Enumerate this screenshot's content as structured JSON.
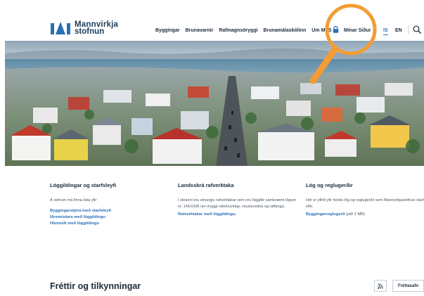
{
  "logo": {
    "line1": "Mannvirkja",
    "line2": "stofnun"
  },
  "nav": {
    "items": [
      "Byggingar",
      "Brunavarnir",
      "Rafmagnsöryggi",
      "Brunamálaskólinn",
      "Um MVS"
    ],
    "my_pages": "Mínar Síður",
    "lang_is": "IS",
    "lang_en": "EN",
    "lock_icon": "lock-icon",
    "search_icon": "search-icon"
  },
  "hero": {
    "description": "Aerial city photo"
  },
  "sections": [
    {
      "title": "Löggildingar og starfsleyfi",
      "intro": "Á vefnum má finna lista yfir:",
      "links": [
        "Byggingarstjóra með starfsleyfi",
        "Iðnmeistara með löggildingu",
        "Hönnuði með löggildingu"
      ]
    },
    {
      "title": "Landsskrá rafverktaka",
      "text": "Í skránni eru einungis rafverktakar sem eru löggiltir samkvæmt lögum nr. 146/1996 um öryggi raforkuvirkja, neysluveitna og raffanga.",
      "link": "Rafverktakar með löggildingu."
    },
    {
      "title": "Lög og reglugerðir",
      "text": "Hér er yfirlit yfir helstu lög og reglugerðir sem Mannvirkjastofnun starfar eftir.",
      "link": "Byggingarreglugerð",
      "link_suffix": " (pdf 2 MB)"
    }
  ],
  "news": {
    "title": "Fréttir og tilkynningar",
    "archive_button": "Fréttasafn",
    "rss_icon": "rss-icon"
  },
  "colors": {
    "accent": "#2a6fb5",
    "highlight": "#f39c34",
    "text": "#1d2b3a"
  }
}
